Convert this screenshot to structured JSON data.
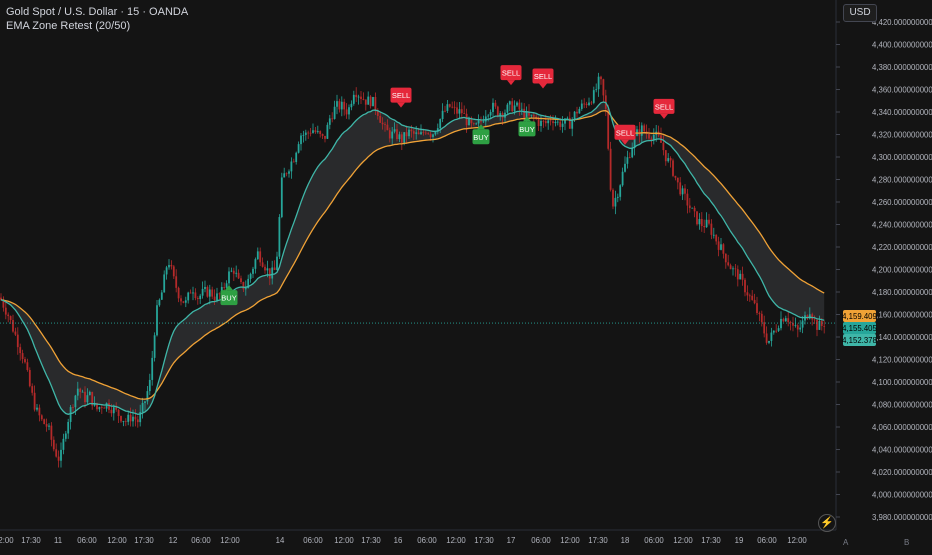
{
  "header": {
    "symbol_line": "Gold Spot / U.S. Dollar · 15 · OANDA",
    "indicator_line": "EMA Zone Retest (20/50)"
  },
  "currency_label": "USD",
  "scale_buttons": {
    "auto": "A",
    "log": "B"
  },
  "colors": {
    "background": "#141414",
    "bull": "#26a69a",
    "bear": "#b52a2a",
    "ema_fast": "#3fb6a8",
    "ema_slow": "#f0a236",
    "zone_fill": "#787b86",
    "buy": "#2ea043",
    "sell": "#e5283b",
    "axis_text": "#b2b5be"
  },
  "chart_data": {
    "type": "candlestick",
    "title": "Gold Spot / U.S. Dollar · 15 · OANDA",
    "ylim": [
      3980,
      4420
    ],
    "x_ticks": [
      "2:00",
      "17:30",
      "11",
      "06:00",
      "12:00",
      "17:30",
      "12",
      "06:00",
      "12:00",
      "14",
      "06:00",
      "12:00",
      "17:30",
      "16",
      "06:00",
      "12:00",
      "17:30",
      "17",
      "06:00",
      "12:00",
      "17:30",
      "18",
      "06:00",
      "12:00",
      "17:30",
      "19",
      "06:00",
      "12:00"
    ],
    "y_ticks": [
      "4,420.000000000",
      "4,400.000000000",
      "4,380.000000000",
      "4,360.000000000",
      "4,340.000000000",
      "4,320.000000000",
      "4,300.000000000",
      "4,280.000000000",
      "4,260.000000000",
      "4,240.000000000",
      "4,220.000000000",
      "4,200.000000000",
      "4,180.000000000",
      "4,160.000000000",
      "4,140.000000000",
      "4,120.000000000",
      "4,100.000000000",
      "4,080.000000000",
      "4,060.000000000",
      "4,040.000000000",
      "4,020.000000000",
      "4,000.000000000",
      "3,980.000000000"
    ],
    "y_tick_values": [
      4420,
      4400,
      4380,
      4360,
      4340,
      4320,
      4300,
      4280,
      4260,
      4240,
      4220,
      4200,
      4180,
      4160,
      4140,
      4120,
      4100,
      4080,
      4060,
      4040,
      4020,
      4000,
      3980
    ],
    "price_anchors": [
      [
        0,
        4175
      ],
      [
        8,
        4160
      ],
      [
        16,
        4140
      ],
      [
        24,
        4120
      ],
      [
        30,
        4095
      ],
      [
        36,
        4075
      ],
      [
        42,
        4065
      ],
      [
        48,
        4060
      ],
      [
        54,
        4040
      ],
      [
        60,
        4030
      ],
      [
        66,
        4060
      ],
      [
        72,
        4080
      ],
      [
        78,
        4095
      ],
      [
        84,
        4085
      ],
      [
        90,
        4088
      ],
      [
        96,
        4075
      ],
      [
        102,
        4080
      ],
      [
        108,
        4080
      ],
      [
        114,
        4075
      ],
      [
        120,
        4070
      ],
      [
        126,
        4065
      ],
      [
        132,
        4070
      ],
      [
        138,
        4065
      ],
      [
        144,
        4080
      ],
      [
        150,
        4100
      ],
      [
        156,
        4160
      ],
      [
        162,
        4180
      ],
      [
        168,
        4210
      ],
      [
        174,
        4190
      ],
      [
        180,
        4175
      ],
      [
        186,
        4170
      ],
      [
        192,
        4185
      ],
      [
        198,
        4175
      ],
      [
        204,
        4180
      ],
      [
        210,
        4180
      ],
      [
        216,
        4175
      ],
      [
        222,
        4180
      ],
      [
        228,
        4195
      ],
      [
        234,
        4200
      ],
      [
        240,
        4185
      ],
      [
        246,
        4185
      ],
      [
        252,
        4200
      ],
      [
        258,
        4215
      ],
      [
        264,
        4205
      ],
      [
        270,
        4195
      ],
      [
        276,
        4200
      ],
      [
        282,
        4280
      ],
      [
        288,
        4290
      ],
      [
        294,
        4300
      ],
      [
        300,
        4320
      ],
      [
        306,
        4320
      ],
      [
        312,
        4325
      ],
      [
        318,
        4320
      ],
      [
        324,
        4315
      ],
      [
        330,
        4335
      ],
      [
        336,
        4345
      ],
      [
        342,
        4345
      ],
      [
        348,
        4340
      ],
      [
        354,
        4360
      ],
      [
        360,
        4355
      ],
      [
        366,
        4350
      ],
      [
        372,
        4350
      ],
      [
        378,
        4340
      ],
      [
        384,
        4325
      ],
      [
        390,
        4320
      ],
      [
        396,
        4320
      ],
      [
        402,
        4315
      ],
      [
        408,
        4322
      ],
      [
        414,
        4320
      ],
      [
        420,
        4318
      ],
      [
        426,
        4325
      ],
      [
        432,
        4320
      ],
      [
        438,
        4330
      ],
      [
        444,
        4340
      ],
      [
        450,
        4345
      ],
      [
        456,
        4340
      ],
      [
        462,
        4340
      ],
      [
        468,
        4330
      ],
      [
        474,
        4325
      ],
      [
        480,
        4330
      ],
      [
        486,
        4340
      ],
      [
        492,
        4345
      ],
      [
        498,
        4340
      ],
      [
        504,
        4340
      ],
      [
        510,
        4345
      ],
      [
        516,
        4345
      ],
      [
        522,
        4340
      ],
      [
        528,
        4335
      ],
      [
        534,
        4335
      ],
      [
        540,
        4330
      ],
      [
        546,
        4330
      ],
      [
        552,
        4335
      ],
      [
        558,
        4330
      ],
      [
        564,
        4330
      ],
      [
        570,
        4330
      ],
      [
        576,
        4340
      ],
      [
        582,
        4345
      ],
      [
        588,
        4350
      ],
      [
        594,
        4355
      ],
      [
        600,
        4370
      ],
      [
        606,
        4340
      ],
      [
        612,
        4255
      ],
      [
        618,
        4270
      ],
      [
        624,
        4290
      ],
      [
        630,
        4305
      ],
      [
        636,
        4320
      ],
      [
        642,
        4325
      ],
      [
        648,
        4320
      ],
      [
        654,
        4320
      ],
      [
        660,
        4315
      ],
      [
        666,
        4300
      ],
      [
        672,
        4290
      ],
      [
        678,
        4275
      ],
      [
        684,
        4265
      ],
      [
        690,
        4255
      ],
      [
        696,
        4245
      ],
      [
        702,
        4240
      ],
      [
        708,
        4240
      ],
      [
        714,
        4230
      ],
      [
        720,
        4220
      ],
      [
        726,
        4210
      ],
      [
        732,
        4200
      ],
      [
        738,
        4195
      ],
      [
        744,
        4185
      ],
      [
        750,
        4175
      ],
      [
        756,
        4165
      ],
      [
        762,
        4150
      ],
      [
        768,
        4135
      ],
      [
        774,
        4145
      ],
      [
        780,
        4155
      ],
      [
        786,
        4160
      ],
      [
        792,
        4150
      ],
      [
        798,
        4145
      ],
      [
        804,
        4155
      ],
      [
        810,
        4165
      ],
      [
        816,
        4150
      ],
      [
        822,
        4150
      ],
      [
        826,
        4155
      ]
    ],
    "ema_fast_last": "4,155.405",
    "ema_slow_last": "4,159.409",
    "close_last": "4,152.378",
    "signals": [
      {
        "type": "BUY",
        "x": 229,
        "price": 4175,
        "label": "BUY"
      },
      {
        "type": "BUY",
        "x": 481,
        "price": 4318,
        "label": "BUY"
      },
      {
        "type": "BUY",
        "x": 527,
        "price": 4325,
        "label": "BUY"
      },
      {
        "type": "SELL",
        "x": 401,
        "price": 4355,
        "label": "SELL"
      },
      {
        "type": "SELL",
        "x": 511,
        "price": 4375,
        "label": "SELL"
      },
      {
        "type": "SELL",
        "x": 543,
        "price": 4372,
        "label": "SELL"
      },
      {
        "type": "SELL",
        "x": 625,
        "price": 4322,
        "label": "SELL"
      },
      {
        "type": "SELL",
        "x": 664,
        "price": 4345,
        "label": "SELL"
      }
    ],
    "dotted_line_price": 4152.378,
    "label_bg": {
      "slow": "#f0a236",
      "fast": "#26a69a",
      "close": "#3fb6a8"
    }
  }
}
